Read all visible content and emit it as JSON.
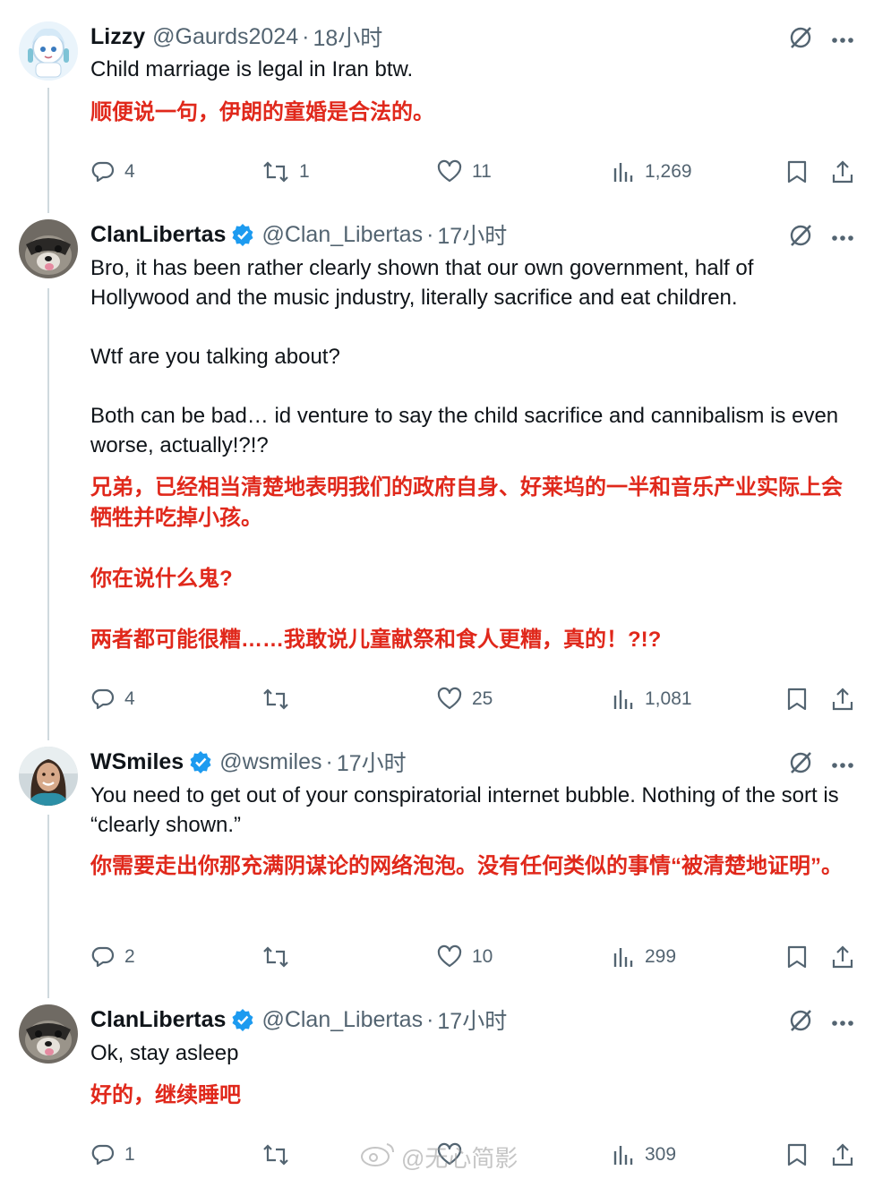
{
  "tweets": [
    {
      "name": "Lizzy",
      "verified": false,
      "handle": "@Gaurds2024",
      "time": "18小时",
      "text_en": [
        "Child marriage is legal in Iran btw."
      ],
      "text_zh": [
        "顺便说一句，伊朗的童婚是合法的。"
      ],
      "replies": "4",
      "retweets": "1",
      "likes": "11",
      "views": "1,269"
    },
    {
      "name": "ClanLibertas",
      "verified": true,
      "handle": "@Clan_Libertas",
      "time": "17小时",
      "text_en": [
        "Bro, it has been rather clearly shown that our own government, half of Hollywood and the music jndustry, literally sacrifice and eat children.",
        "Wtf are you talking about?",
        "Both can be bad… id venture to say the child sacrifice and cannibalism is even worse, actually!?!?"
      ],
      "text_zh": [
        "兄弟，已经相当清楚地表明我们的政府自身、好莱坞的一半和音乐产业实际上会牺牲并吃掉小孩。",
        "你在说什么鬼?",
        "两者都可能很糟……我敢说儿童献祭和食人更糟，真的！?!?"
      ],
      "replies": "4",
      "retweets": "",
      "likes": "25",
      "views": "1,081"
    },
    {
      "name": "WSmiles",
      "verified": true,
      "handle": "@wsmiles",
      "time": "17小时",
      "text_en": [
        "You need to get out of your conspiratorial internet bubble. Nothing of the sort is “clearly shown.”"
      ],
      "text_zh": [
        "你需要走出你那充满阴谋论的网络泡泡。没有任何类似的事情“被清楚地证明”。"
      ],
      "replies": "2",
      "retweets": "",
      "likes": "10",
      "views": "299"
    },
    {
      "name": "ClanLibertas",
      "verified": true,
      "handle": "@Clan_Libertas",
      "time": "17小时",
      "text_en": [
        "Ok, stay asleep"
      ],
      "text_zh": [
        "好的，继续睡吧"
      ],
      "replies": "1",
      "retweets": "",
      "likes": "",
      "views": "309"
    }
  ],
  "separator": "·",
  "watermark": "@无心简影",
  "colors": {
    "accent": "#1d9bf0",
    "translation": "#e0281b",
    "muted": "#536471"
  },
  "icons": [
    "grok-icon",
    "more-icon",
    "reply-icon",
    "retweet-icon",
    "like-icon",
    "views-icon",
    "bookmark-icon",
    "share-icon",
    "verified-badge-icon"
  ]
}
